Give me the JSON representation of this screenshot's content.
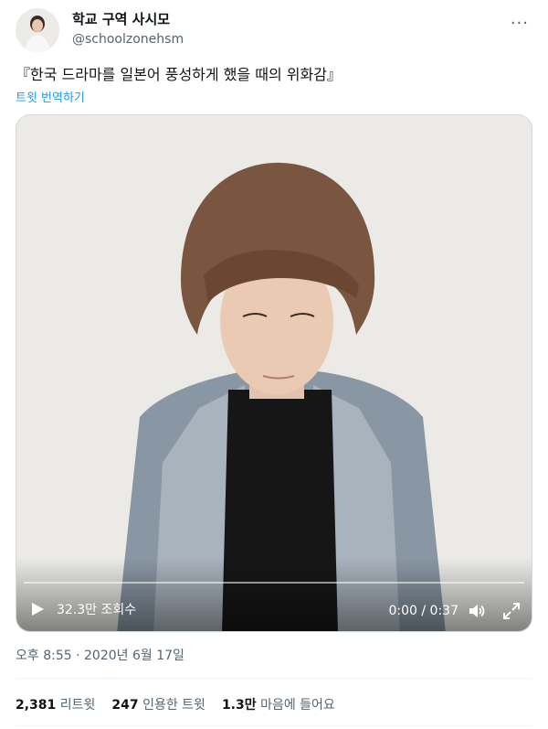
{
  "author": {
    "display_name": "학교 구역 사시모",
    "handle": "@schoolzonehsm"
  },
  "more_icon": "more-horizontal-icon",
  "tweet": {
    "text": "『한국 드라마를 일본어 풍성하게 했을 때의 위화감』",
    "translate_label": "트윗 번역하기"
  },
  "video": {
    "views": "32.3만 조회수",
    "time": "0:00 / 0:37",
    "progress": 0,
    "icons": [
      "play-icon",
      "volume-icon",
      "fullscreen-icon"
    ]
  },
  "meta": {
    "timestamp": "오후 8:55 · 2020년 6월 17일"
  },
  "stats": [
    {
      "count": "2,381",
      "label": "리트윗"
    },
    {
      "count": "247",
      "label": "인용한 트윗"
    },
    {
      "count": "1.3만",
      "label": "마음에 들어요"
    }
  ],
  "colors": {
    "link": "#1d9bf0",
    "muted": "#536471",
    "text": "#0f1419"
  }
}
